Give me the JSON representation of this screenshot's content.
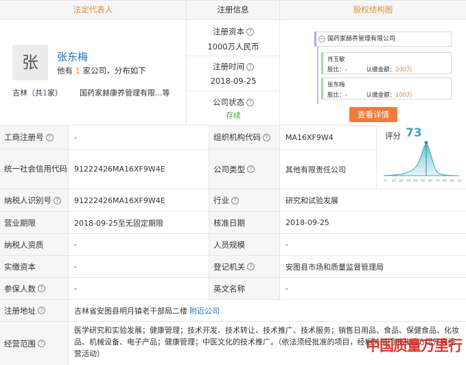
{
  "headers": {
    "legal_rep": "法定代表人",
    "reg_info": "注册信息",
    "equity": "股权结构图"
  },
  "person": {
    "avatar_char": "张",
    "name": "张东梅",
    "desc_prefix": "他有",
    "desc_count": "1",
    "desc_suffix": "家公司，分布如下",
    "location_prefix": "吉林（共",
    "location_count": "1",
    "location_suffix": "家）",
    "company": "国药家赫康养管理有限...等"
  },
  "registration": {
    "capital_label": "注册资本",
    "capital_value": "1000万人民币",
    "time_label": "注册时间",
    "time_value": "2018-09-25",
    "status_label": "公司状态",
    "status_value": "存续"
  },
  "equity": {
    "root": "国药家赫养管理有限公司",
    "shareholders": [
      {
        "name": "肖玉敏",
        "ratio_label": "股比：",
        "ratio": "-",
        "amount_label": "认缴金额：",
        "amount": "200万"
      },
      {
        "name": "张东梅",
        "ratio_label": "股比：",
        "ratio": "-",
        "amount_label": "认缴金额：",
        "amount": "100万"
      }
    ],
    "detail_button": "查看详情"
  },
  "score": {
    "label": "评分",
    "value": "73",
    "axis_ticks": [
      "0",
      "10",
      "20",
      "30",
      "40",
      "50",
      "60",
      "70",
      "80",
      "90",
      "100"
    ]
  },
  "table": {
    "rows": [
      {
        "k1": "工商注册号",
        "v1": "-",
        "k2": "组织机构代码",
        "v2": "MA16XF9W4"
      },
      {
        "k1": "统一社会信用代码",
        "v1": "91222426MA16XF9W4E",
        "k2": "公司类型",
        "v2": "其他有限责任公司"
      },
      {
        "k1": "纳税人识别号",
        "v1": "91222426MA16XF9W4E",
        "k2": "行业",
        "v2": "研究和试验发展"
      },
      {
        "k1": "营业期限",
        "v1": "2018-09-25至无固定期限",
        "k2": "核准日期",
        "v2": "2018-09-25"
      },
      {
        "k1": "纳税人资质",
        "v1": "-",
        "k2": "人员规模",
        "v2": "-"
      },
      {
        "k1": "实缴资本",
        "v1": "-",
        "k2": "登记机关",
        "v2": "安图县市场和质量监督管理局"
      },
      {
        "k1": "参保人数",
        "v1": "-",
        "k2": "英文名称",
        "v2": "-"
      }
    ],
    "address_label": "注册地址",
    "address_value": "吉林省安图县明月镇老干部局二楼",
    "address_link": "附近公司",
    "scope_label": "经营范围",
    "scope_value": "医学研究和实验发展；健康管理；技术开发、技术转让、技术推广、技术服务；销售日用品、食品、保健食品、化妆品、机械设备、电子产品；健康管理；中医文化的技术推广。（依法须经批准的项目，经相关部门批准后方可开展经营活动）"
  },
  "watermark": "中国质量万里行"
}
